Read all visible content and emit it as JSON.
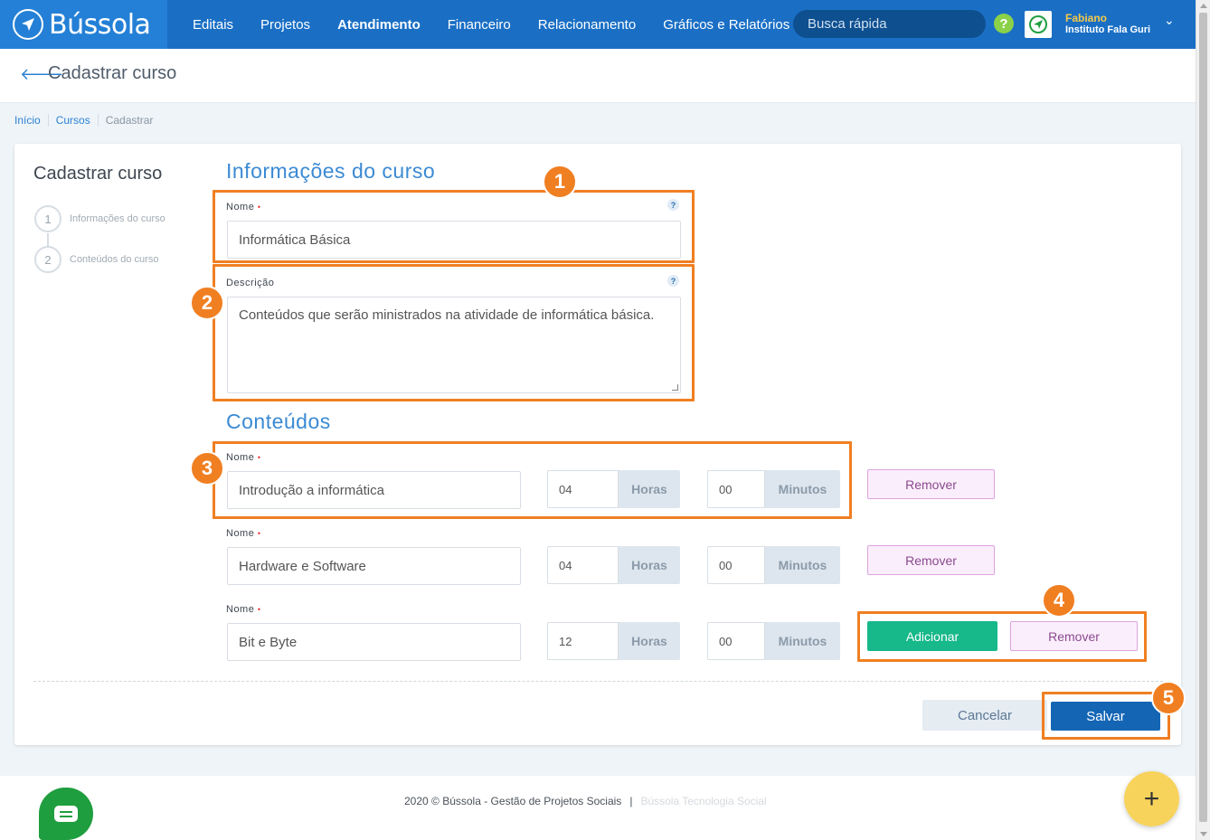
{
  "header": {
    "app_name": "Bússola",
    "nav": [
      {
        "label": "Editais",
        "active": false
      },
      {
        "label": "Projetos",
        "active": false
      },
      {
        "label": "Atendimento",
        "active": true
      },
      {
        "label": "Financeiro",
        "active": false
      },
      {
        "label": "Relacionamento",
        "active": false
      },
      {
        "label": "Gráficos e Relatórios",
        "active": false
      }
    ],
    "search_placeholder": "Busca rápida",
    "help_label": "?",
    "user_name": "Fabiano",
    "user_org": "Instituto Fala Guri",
    "colors": {
      "nav_bg": "#1a6fc5",
      "accent": "#f5c94a"
    }
  },
  "page": {
    "title": "Cadastrar curso",
    "breadcrumb": [
      "Início",
      "Cursos",
      "Cadastrar"
    ]
  },
  "steps": {
    "title": "Cadastrar curso",
    "items": [
      {
        "num": "1",
        "label": "Informações do curso"
      },
      {
        "num": "2",
        "label": "Conteúdos do curso"
      }
    ]
  },
  "info": {
    "section_title": "Informações do curso",
    "name_label": "Nome",
    "name_value": "Informática Básica",
    "desc_label": "Descrição",
    "desc_value": "Conteúdos que serão ministrados na atividade de informática básica.",
    "help_mark": "?",
    "required_mark": "•"
  },
  "contents": {
    "section_title": "Conteúdos",
    "row_label": "Nome",
    "hours_unit": "Horas",
    "minutes_unit": "Minutos",
    "remove_label": "Remover",
    "add_label": "Adicionar",
    "rows": [
      {
        "name": "Introdução a informática",
        "hours": "04",
        "minutes": "00"
      },
      {
        "name": "Hardware e Software",
        "hours": "04",
        "minutes": "00"
      },
      {
        "name": "Bit e Byte",
        "hours": "12",
        "minutes": "00"
      }
    ]
  },
  "actions": {
    "cancel": "Cancelar",
    "save": "Salvar"
  },
  "annotations": [
    "1",
    "2",
    "3",
    "4",
    "5"
  ],
  "footer": {
    "copyright": "2020 © Bússola - Gestão de Projetos Sociais",
    "separator": "|",
    "link": "Bússola Tecnologia Social"
  },
  "fab_label": "+"
}
